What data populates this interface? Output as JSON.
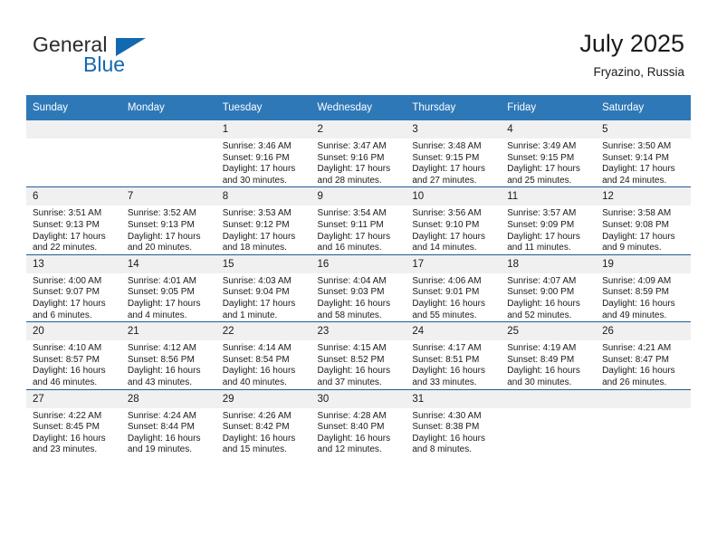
{
  "brand": {
    "name_top": "General",
    "name_bottom": "Blue",
    "accent_color": "#1269b0",
    "triangle_icon": "triangle-icon"
  },
  "header": {
    "title": "July 2025",
    "subtitle": "Fryazino, Russia"
  },
  "theme": {
    "header_row_bg": "#2e78b8",
    "day_number_bg": "#f0f0f0",
    "row_border": "#1f5d96",
    "text": "#1a1a1a"
  },
  "calendar": {
    "weekday_headers": [
      "Sunday",
      "Monday",
      "Tuesday",
      "Wednesday",
      "Thursday",
      "Friday",
      "Saturday"
    ],
    "labels": {
      "sunrise": "Sunrise:",
      "sunset": "Sunset:",
      "daylight": "Daylight:"
    },
    "weeks": [
      [
        {
          "day": "",
          "empty": true
        },
        {
          "day": "",
          "empty": true
        },
        {
          "day": "1",
          "sunrise": "Sunrise: 3:46 AM",
          "sunset": "Sunset: 9:16 PM",
          "daylight": "Daylight: 17 hours and 30 minutes."
        },
        {
          "day": "2",
          "sunrise": "Sunrise: 3:47 AM",
          "sunset": "Sunset: 9:16 PM",
          "daylight": "Daylight: 17 hours and 28 minutes."
        },
        {
          "day": "3",
          "sunrise": "Sunrise: 3:48 AM",
          "sunset": "Sunset: 9:15 PM",
          "daylight": "Daylight: 17 hours and 27 minutes."
        },
        {
          "day": "4",
          "sunrise": "Sunrise: 3:49 AM",
          "sunset": "Sunset: 9:15 PM",
          "daylight": "Daylight: 17 hours and 25 minutes."
        },
        {
          "day": "5",
          "sunrise": "Sunrise: 3:50 AM",
          "sunset": "Sunset: 9:14 PM",
          "daylight": "Daylight: 17 hours and 24 minutes."
        }
      ],
      [
        {
          "day": "6",
          "sunrise": "Sunrise: 3:51 AM",
          "sunset": "Sunset: 9:13 PM",
          "daylight": "Daylight: 17 hours and 22 minutes."
        },
        {
          "day": "7",
          "sunrise": "Sunrise: 3:52 AM",
          "sunset": "Sunset: 9:13 PM",
          "daylight": "Daylight: 17 hours and 20 minutes."
        },
        {
          "day": "8",
          "sunrise": "Sunrise: 3:53 AM",
          "sunset": "Sunset: 9:12 PM",
          "daylight": "Daylight: 17 hours and 18 minutes."
        },
        {
          "day": "9",
          "sunrise": "Sunrise: 3:54 AM",
          "sunset": "Sunset: 9:11 PM",
          "daylight": "Daylight: 17 hours and 16 minutes."
        },
        {
          "day": "10",
          "sunrise": "Sunrise: 3:56 AM",
          "sunset": "Sunset: 9:10 PM",
          "daylight": "Daylight: 17 hours and 14 minutes."
        },
        {
          "day": "11",
          "sunrise": "Sunrise: 3:57 AM",
          "sunset": "Sunset: 9:09 PM",
          "daylight": "Daylight: 17 hours and 11 minutes."
        },
        {
          "day": "12",
          "sunrise": "Sunrise: 3:58 AM",
          "sunset": "Sunset: 9:08 PM",
          "daylight": "Daylight: 17 hours and 9 minutes."
        }
      ],
      [
        {
          "day": "13",
          "sunrise": "Sunrise: 4:00 AM",
          "sunset": "Sunset: 9:07 PM",
          "daylight": "Daylight: 17 hours and 6 minutes."
        },
        {
          "day": "14",
          "sunrise": "Sunrise: 4:01 AM",
          "sunset": "Sunset: 9:05 PM",
          "daylight": "Daylight: 17 hours and 4 minutes."
        },
        {
          "day": "15",
          "sunrise": "Sunrise: 4:03 AM",
          "sunset": "Sunset: 9:04 PM",
          "daylight": "Daylight: 17 hours and 1 minute."
        },
        {
          "day": "16",
          "sunrise": "Sunrise: 4:04 AM",
          "sunset": "Sunset: 9:03 PM",
          "daylight": "Daylight: 16 hours and 58 minutes."
        },
        {
          "day": "17",
          "sunrise": "Sunrise: 4:06 AM",
          "sunset": "Sunset: 9:01 PM",
          "daylight": "Daylight: 16 hours and 55 minutes."
        },
        {
          "day": "18",
          "sunrise": "Sunrise: 4:07 AM",
          "sunset": "Sunset: 9:00 PM",
          "daylight": "Daylight: 16 hours and 52 minutes."
        },
        {
          "day": "19",
          "sunrise": "Sunrise: 4:09 AM",
          "sunset": "Sunset: 8:59 PM",
          "daylight": "Daylight: 16 hours and 49 minutes."
        }
      ],
      [
        {
          "day": "20",
          "sunrise": "Sunrise: 4:10 AM",
          "sunset": "Sunset: 8:57 PM",
          "daylight": "Daylight: 16 hours and 46 minutes."
        },
        {
          "day": "21",
          "sunrise": "Sunrise: 4:12 AM",
          "sunset": "Sunset: 8:56 PM",
          "daylight": "Daylight: 16 hours and 43 minutes."
        },
        {
          "day": "22",
          "sunrise": "Sunrise: 4:14 AM",
          "sunset": "Sunset: 8:54 PM",
          "daylight": "Daylight: 16 hours and 40 minutes."
        },
        {
          "day": "23",
          "sunrise": "Sunrise: 4:15 AM",
          "sunset": "Sunset: 8:52 PM",
          "daylight": "Daylight: 16 hours and 37 minutes."
        },
        {
          "day": "24",
          "sunrise": "Sunrise: 4:17 AM",
          "sunset": "Sunset: 8:51 PM",
          "daylight": "Daylight: 16 hours and 33 minutes."
        },
        {
          "day": "25",
          "sunrise": "Sunrise: 4:19 AM",
          "sunset": "Sunset: 8:49 PM",
          "daylight": "Daylight: 16 hours and 30 minutes."
        },
        {
          "day": "26",
          "sunrise": "Sunrise: 4:21 AM",
          "sunset": "Sunset: 8:47 PM",
          "daylight": "Daylight: 16 hours and 26 minutes."
        }
      ],
      [
        {
          "day": "27",
          "sunrise": "Sunrise: 4:22 AM",
          "sunset": "Sunset: 8:45 PM",
          "daylight": "Daylight: 16 hours and 23 minutes."
        },
        {
          "day": "28",
          "sunrise": "Sunrise: 4:24 AM",
          "sunset": "Sunset: 8:44 PM",
          "daylight": "Daylight: 16 hours and 19 minutes."
        },
        {
          "day": "29",
          "sunrise": "Sunrise: 4:26 AM",
          "sunset": "Sunset: 8:42 PM",
          "daylight": "Daylight: 16 hours and 15 minutes."
        },
        {
          "day": "30",
          "sunrise": "Sunrise: 4:28 AM",
          "sunset": "Sunset: 8:40 PM",
          "daylight": "Daylight: 16 hours and 12 minutes."
        },
        {
          "day": "31",
          "sunrise": "Sunrise: 4:30 AM",
          "sunset": "Sunset: 8:38 PM",
          "daylight": "Daylight: 16 hours and 8 minutes."
        },
        {
          "day": "",
          "empty": true
        },
        {
          "day": "",
          "empty": true
        }
      ]
    ]
  }
}
